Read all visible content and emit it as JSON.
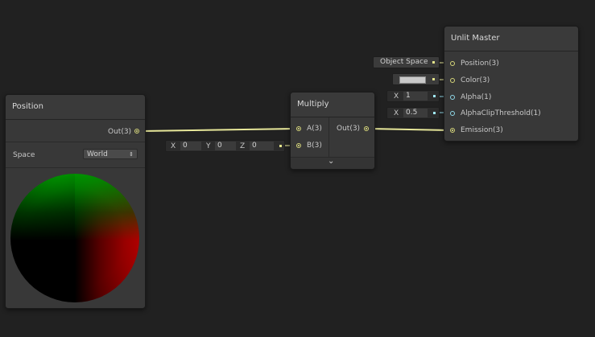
{
  "colors": {
    "background": "#212121",
    "node_body": "#383838",
    "wire_yellow": "#e8e89a",
    "wire_cyan": "#8fd8e8",
    "color_swatch": "#c9c9c9"
  },
  "position_node": {
    "title": "Position",
    "output_label": "Out(3)",
    "space_label": "Space",
    "space_value": "World",
    "dropdown_icon": "updown-arrow-icon"
  },
  "vector_input": {
    "x_label": "X",
    "x_value": "0",
    "y_label": "Y",
    "y_value": "0",
    "z_label": "Z",
    "z_value": "0"
  },
  "multiply_node": {
    "title": "Multiply",
    "input_a": "A(3)",
    "input_b": "B(3)",
    "output_label": "Out(3)",
    "expand_icon": "chevron-down-icon"
  },
  "master_node": {
    "title": "Unlit Master",
    "ports": [
      "Position(3)",
      "Color(3)",
      "Alpha(1)",
      "AlphaClipThreshold(1)",
      "Emission(3)"
    ]
  },
  "master_inputs": {
    "position_space": "Object Space",
    "alpha_x_label": "X",
    "alpha_value": "1",
    "clip_x_label": "X",
    "clip_value": "0.5"
  }
}
